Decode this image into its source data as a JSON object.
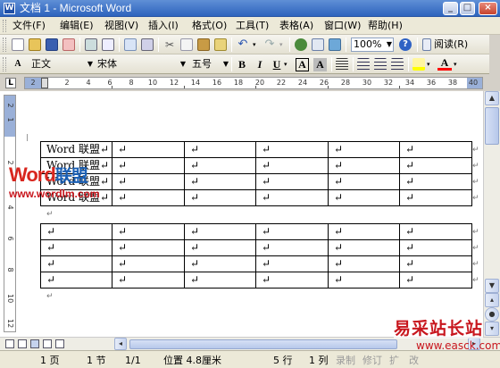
{
  "window": {
    "title": "文档 1 - Microsoft Word",
    "app_icon": "W"
  },
  "menubar": {
    "items": [
      "文件(F)",
      "编辑(E)",
      "视图(V)",
      "插入(I)",
      "格式(O)",
      "工具(T)",
      "表格(A)",
      "窗口(W)",
      "帮助(H)"
    ]
  },
  "toolbar_standard": {
    "zoom": "100%",
    "read_label": "阅读(R)"
  },
  "toolbar_formatting": {
    "style": "正文",
    "font": "宋体",
    "size": "五号",
    "bold": "B",
    "italic": "I",
    "underline": "U",
    "char_border": "A",
    "char_shading": "A",
    "font_color": "A",
    "colors": {
      "highlight": "#ffff00",
      "font_color": "#ff0000"
    }
  },
  "ruler": {
    "corner": "L",
    "numbers": [
      "2",
      "2",
      "4",
      "6",
      "8",
      "10",
      "12",
      "14",
      "16",
      "18",
      "20",
      "22",
      "24",
      "26",
      "28",
      "30",
      "32",
      "34",
      "36",
      "38",
      "40"
    ],
    "vertical_numbers": [
      "2",
      "1",
      "2",
      "4",
      "6",
      "8",
      "10",
      "12"
    ]
  },
  "document": {
    "table1": {
      "rows": [
        [
          "Word 联盟↵",
          "↵",
          "↵",
          "↵",
          "↵",
          "↵"
        ],
        [
          "Word 联盟↵",
          "↵",
          "↵",
          "↵",
          "↵",
          "↵"
        ],
        [
          "Word 联盟↵",
          "↵",
          "↵",
          "↵",
          "↵",
          "↵"
        ],
        [
          "Word 联盟↵",
          "↵",
          "↵",
          "↵",
          "↵",
          "↵"
        ]
      ]
    },
    "table2": {
      "rows": [
        [
          "↵",
          "↵",
          "↵",
          "↵",
          "↵",
          "↵"
        ],
        [
          "↵",
          "↵",
          "↵",
          "↵",
          "↵",
          "↵"
        ],
        [
          "↵",
          "↵",
          "↵",
          "↵",
          "↵",
          "↵"
        ],
        [
          "↵",
          "↵",
          "↵",
          "↵",
          "↵",
          "↵"
        ]
      ]
    },
    "row_end_mark": "↵",
    "paragraph_mark": "↵"
  },
  "watermarks": {
    "logo_word": "Word",
    "logo_cn": "联盟",
    "logo_url": "www.wordlm.com",
    "site_name": "易采站长站",
    "site_url": "www.easck.com"
  },
  "statusbar": {
    "page": "1 页",
    "section": "1 节",
    "page_of": "1/1",
    "position": "位置 4.8厘米",
    "line": "5 行",
    "column": "1 列",
    "rec": "录制",
    "trk": "修订",
    "ext": "扩",
    "ovr": "改"
  }
}
